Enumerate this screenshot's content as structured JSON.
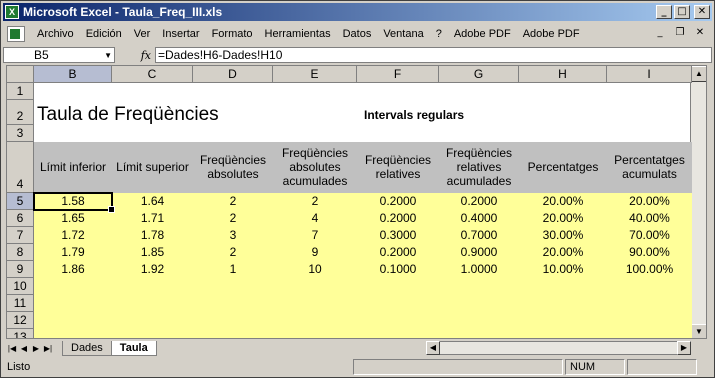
{
  "window": {
    "title": "Microsoft Excel - Taula_Freq_III.xls",
    "app_icon": "X"
  },
  "menu": {
    "items": [
      "Archivo",
      "Edición",
      "Ver",
      "Insertar",
      "Formato",
      "Herramientas",
      "Datos",
      "Ventana",
      "?",
      "Adobe PDF",
      "Adobe PDF"
    ]
  },
  "formula_bar": {
    "name_box": "B5",
    "fx": "fx",
    "formula": "=Dades!H6-Dades!H10"
  },
  "columns": [
    "B",
    "C",
    "D",
    "E",
    "F",
    "G",
    "H",
    "I"
  ],
  "rows": [
    "1",
    "2",
    "3",
    "4",
    "5",
    "6",
    "7",
    "8",
    "9",
    "10",
    "11",
    "12",
    "13"
  ],
  "sheet": {
    "title": "Taula de Freqüències",
    "subtitle": "Intervals regulars",
    "headers": [
      [
        "Límit inferior"
      ],
      [
        "Límit superior"
      ],
      [
        "Freqüències",
        "absolutes"
      ],
      [
        "Freqüències",
        "absolutes",
        "acumulades"
      ],
      [
        "Freqüències",
        "relatives"
      ],
      [
        "Freqüències",
        "relatives",
        "acumulades"
      ],
      [
        "Percentatges"
      ],
      [
        "Percentatges",
        "acumulats"
      ]
    ],
    "data": [
      [
        "1.58",
        "1.64",
        "2",
        "2",
        "0.2000",
        "0.2000",
        "20.00%",
        "20.00%"
      ],
      [
        "1.65",
        "1.71",
        "2",
        "4",
        "0.2000",
        "0.4000",
        "20.00%",
        "40.00%"
      ],
      [
        "1.72",
        "1.78",
        "3",
        "7",
        "0.3000",
        "0.7000",
        "30.00%",
        "70.00%"
      ],
      [
        "1.79",
        "1.85",
        "2",
        "9",
        "0.2000",
        "0.9000",
        "20.00%",
        "90.00%"
      ],
      [
        "1.86",
        "1.92",
        "1",
        "10",
        "0.1000",
        "1.0000",
        "10.00%",
        "100.00%"
      ]
    ]
  },
  "tabs": {
    "sheets": [
      "Dades",
      "Taula"
    ],
    "active": "Taula"
  },
  "status": {
    "ready": "Listo",
    "num": "NUM"
  },
  "colors": {
    "header_gray": "#c0c0c0",
    "data_yellow": "#ffff99",
    "title_blue": "#0a246a"
  }
}
